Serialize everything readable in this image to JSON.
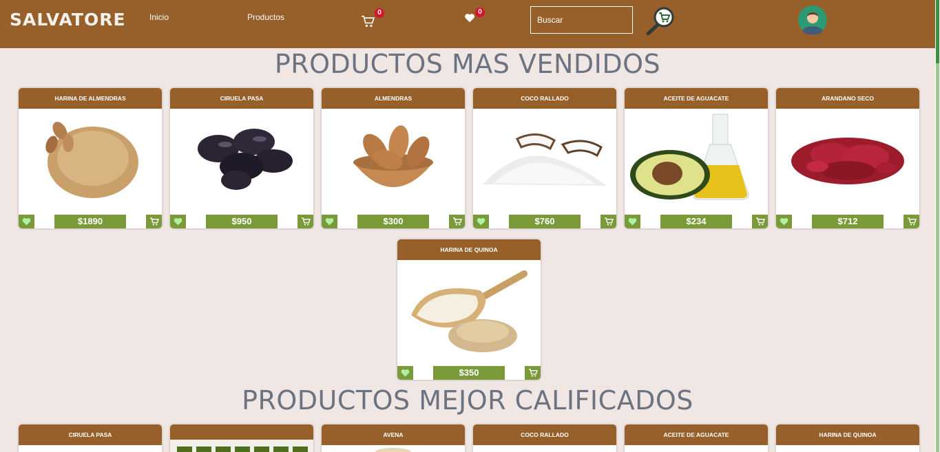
{
  "header": {
    "logo": "SALVATORE",
    "nav": {
      "inicio": "Inicio",
      "productos": "Productos"
    },
    "cart_count": "0",
    "fav_count": "0",
    "search_placeholder": "Buscar"
  },
  "colors": {
    "header_bg": "#97602a",
    "accent_green": "#7a9a3a",
    "page_bg": "#f0e6e4",
    "badge": "#d7142e"
  },
  "best_sellers": {
    "title": "PRODUCTOS MAS VENDIDOS",
    "products": [
      {
        "name": "HARINA DE ALMENDRAS",
        "price": "$1890"
      },
      {
        "name": "CIRUELA PASA",
        "price": "$950"
      },
      {
        "name": "ALMENDRAS",
        "price": "$300"
      },
      {
        "name": "COCO RALLADO",
        "price": "$760"
      },
      {
        "name": "ACEITE DE AGUACATE",
        "price": "$234"
      },
      {
        "name": "ARANDANO SECO",
        "price": "$712"
      },
      {
        "name": "HARINA DE QUINOA",
        "price": "$350"
      }
    ]
  },
  "top_rated": {
    "title": "PRODUCTOS MEJOR CALIFICADOS",
    "products": [
      {
        "name": "CIRUELA PASA"
      },
      {
        "name": ""
      },
      {
        "name": "AVENA"
      },
      {
        "name": "COCO RALLADO"
      },
      {
        "name": "ACEITE DE AGUACATE"
      },
      {
        "name": "HARINA DE QUINOA"
      }
    ]
  }
}
